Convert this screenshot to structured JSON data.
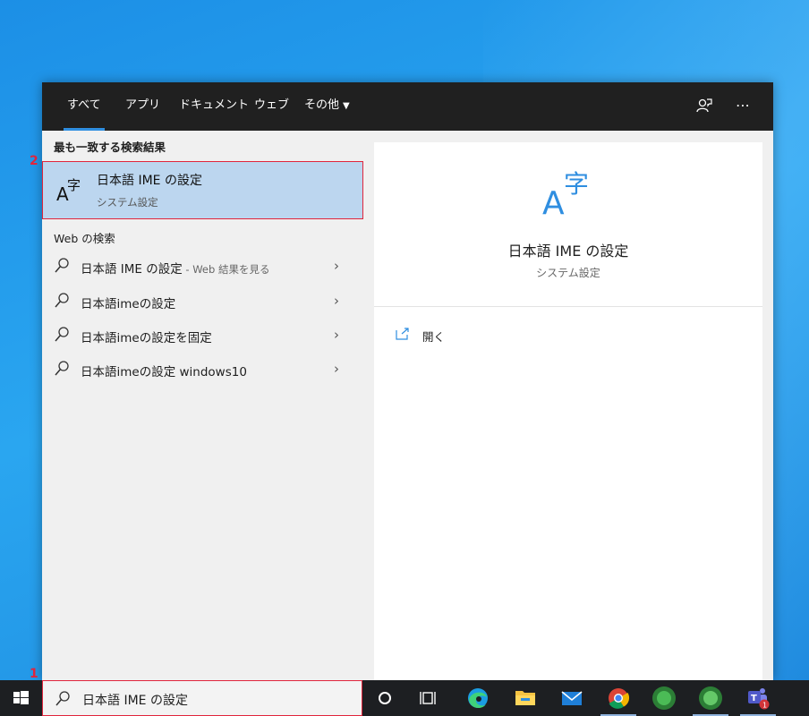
{
  "tabs": [
    {
      "label": "すべて"
    },
    {
      "label": "アプリ"
    },
    {
      "label": "ドキュメント"
    },
    {
      "label": "ウェブ"
    },
    {
      "label": "その他"
    }
  ],
  "topbar_icons": [
    "feedback-icon",
    "more-options-icon"
  ],
  "best_match": {
    "heading": "最も一致する検索結果",
    "title": "日本語 IME の設定",
    "subtitle": "システム設定",
    "icon": "ime-settings-icon"
  },
  "web_search": {
    "heading": "Web の検索",
    "items": [
      {
        "text": "日本語 IME の設定",
        "suffix": " - Web 結果を見る"
      },
      {
        "text": "日本語imeの設定",
        "suffix": ""
      },
      {
        "text": "日本語imeの設定を固定",
        "suffix": ""
      },
      {
        "text": "日本語imeの設定 windows10",
        "suffix": ""
      }
    ]
  },
  "detail": {
    "title": "日本語 IME の設定",
    "subtitle": "システム設定",
    "open_label": "開く"
  },
  "taskbar": {
    "search_value": "日本語 IME の設定",
    "icons": [
      "windows-start-icon",
      "cortana-icon",
      "task-view-icon",
      "edge-icon",
      "file-explorer-icon",
      "mail-icon",
      "chrome-icon",
      "blurred-app-icon",
      "blurred-app-icon",
      "teams-icon"
    ],
    "teams_badge": "1"
  },
  "steps": {
    "step1": "1",
    "step2": "2"
  },
  "colors": {
    "accent": "#2f8ee0",
    "highlight": "#bcd6ef",
    "annotation_red": "#e0253c",
    "panel_dark": "#202020",
    "taskbar": "#1d1f22"
  }
}
